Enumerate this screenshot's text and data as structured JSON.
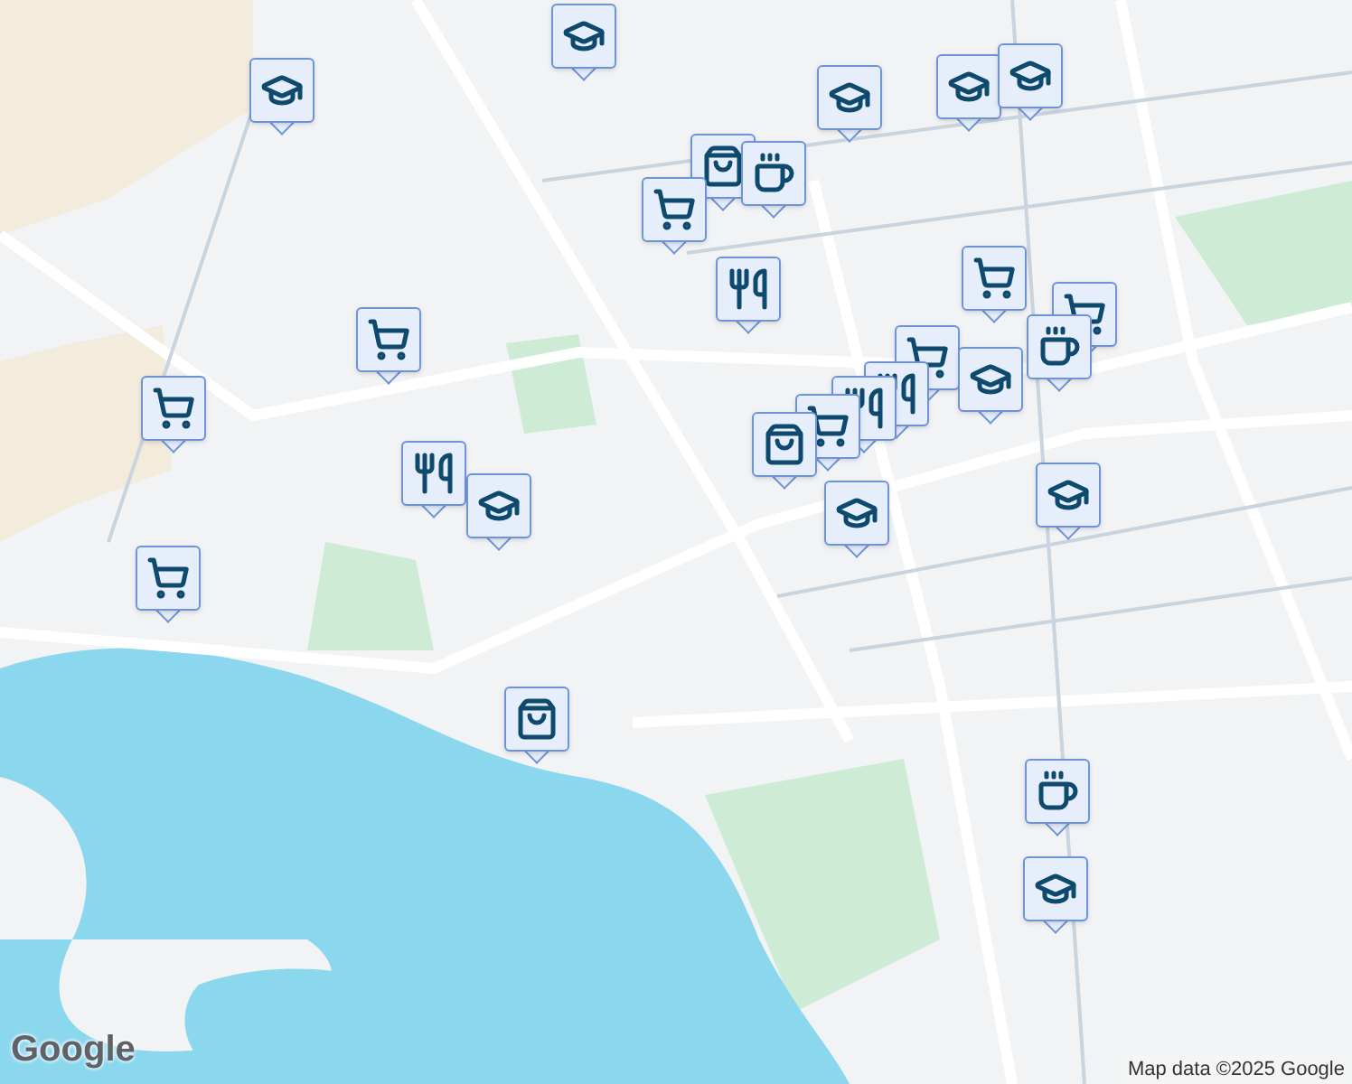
{
  "map": {
    "pins": [
      {
        "kind": "school"
      },
      {
        "kind": "school"
      },
      {
        "kind": "school"
      },
      {
        "kind": "school"
      },
      {
        "kind": "school"
      },
      {
        "kind": "bag"
      },
      {
        "kind": "cafe"
      },
      {
        "kind": "cart"
      },
      {
        "kind": "restaurant"
      },
      {
        "kind": "cart"
      },
      {
        "kind": "cart"
      },
      {
        "kind": "cart"
      },
      {
        "kind": "cart"
      },
      {
        "kind": "cart"
      },
      {
        "kind": "restaurant"
      },
      {
        "kind": "restaurant"
      },
      {
        "kind": "cart"
      },
      {
        "kind": "bag"
      },
      {
        "kind": "cafe"
      },
      {
        "kind": "school"
      },
      {
        "kind": "restaurant"
      },
      {
        "kind": "school"
      },
      {
        "kind": "school"
      },
      {
        "kind": "school"
      },
      {
        "kind": "cart"
      },
      {
        "kind": "bag"
      },
      {
        "kind": "cafe"
      },
      {
        "kind": "school"
      }
    ]
  },
  "logo": "Google",
  "attribution": "Map data ©2025 Google"
}
